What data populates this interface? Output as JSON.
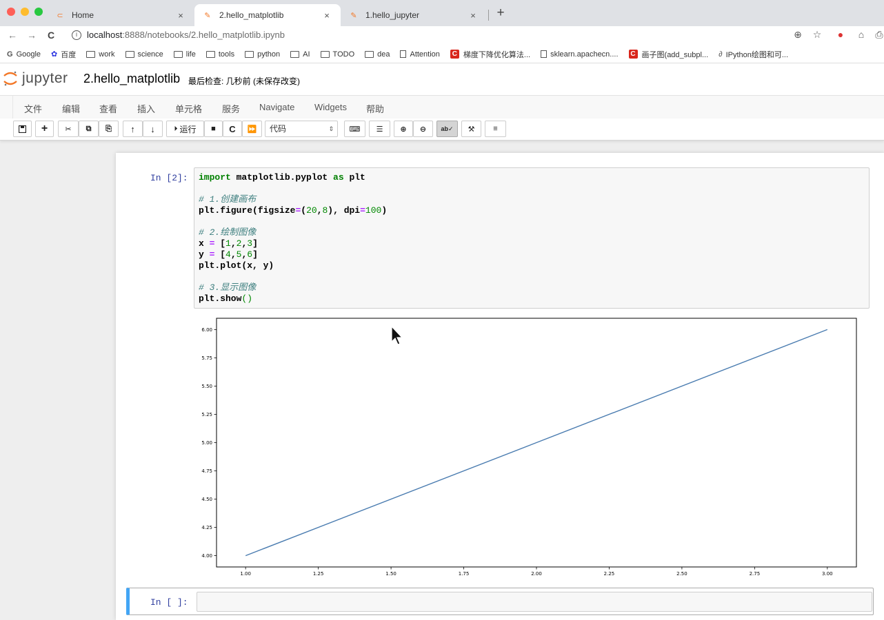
{
  "browser": {
    "tabs": [
      {
        "title": "Home",
        "close": "×"
      },
      {
        "title": "2.hello_matplotlib",
        "close": "×"
      },
      {
        "title": "1.hello_jupyter",
        "close": "×"
      }
    ],
    "new_tab": "+",
    "url_host": "localhost",
    "url_path": ":8888/notebooks/2.hello_matplotlib.ipynb",
    "bookmarks": [
      {
        "label": "Google",
        "kind": "google"
      },
      {
        "label": "百度",
        "kind": "baidu"
      },
      {
        "label": "work",
        "kind": "folder"
      },
      {
        "label": "science",
        "kind": "folder"
      },
      {
        "label": "life",
        "kind": "folder"
      },
      {
        "label": "tools",
        "kind": "folder"
      },
      {
        "label": "python",
        "kind": "folder"
      },
      {
        "label": "AI",
        "kind": "folder"
      },
      {
        "label": "TODO",
        "kind": "folder"
      },
      {
        "label": "dea",
        "kind": "folder"
      },
      {
        "label": "Attention",
        "kind": "doc"
      },
      {
        "label": "梯度下降优化算法...",
        "kind": "csdn"
      },
      {
        "label": "sklearn.apachecn....",
        "kind": "doc"
      },
      {
        "label": "画子图(add_subpl...",
        "kind": "csdn"
      },
      {
        "label": "IPython绘图和可...",
        "kind": "other"
      }
    ]
  },
  "jupyter": {
    "brand": "jupyter",
    "notebook_name": "2.hello_matplotlib",
    "checkpoint": "最后检查: 几秒前  (未保存改变)",
    "menus": [
      "文件",
      "编辑",
      "查看",
      "插入",
      "单元格",
      "服务",
      "Navigate",
      "Widgets",
      "帮助"
    ],
    "toolbar": {
      "run_label": "运行",
      "cell_type": "代码"
    }
  },
  "cells": [
    {
      "prompt": "In [2]:",
      "code": {
        "l1": {
          "k": "import",
          "a": " matplotlib.pyplot ",
          "k2": "as",
          "b": " plt"
        },
        "c1": "# 1.创建画布",
        "l2": {
          "a": "plt.figure(figsize",
          "eq": "=",
          "p1": "(",
          "n1": "20",
          "c": ",",
          "n2": "8",
          "p2": "), dpi",
          "eq2": "=",
          "n3": "100",
          "e": ")"
        },
        "c2": "# 2.绘制图像",
        "l3": {
          "a": "x ",
          "eq": "=",
          "b": " [",
          "n1": "1",
          "c1": ",",
          "n2": "2",
          "c2": ",",
          "n3": "3",
          "e": "]"
        },
        "l4": {
          "a": "y ",
          "eq": "=",
          "b": " [",
          "n1": "4",
          "c1": ",",
          "n2": "5",
          "c2": ",",
          "n3": "6",
          "e": "]"
        },
        "l5": "plt.plot(x, y)",
        "c3": "# 3.显示图像",
        "l6": {
          "a": "plt.show",
          "p": "()"
        }
      }
    },
    {
      "prompt": "In [ ]:"
    }
  ],
  "chart_data": {
    "type": "line",
    "x": [
      1.0,
      2.0,
      3.0
    ],
    "series": [
      {
        "values": [
          4,
          5,
          6
        ],
        "color": "#4a7cb0"
      }
    ],
    "xlim": [
      0.9,
      3.1
    ],
    "ylim": [
      3.9,
      6.1
    ],
    "xticks": [
      "1.00",
      "1.25",
      "1.50",
      "1.75",
      "2.00",
      "2.25",
      "2.50",
      "2.75",
      "3.00"
    ],
    "xtick_values": [
      1.0,
      1.25,
      1.5,
      1.75,
      2.0,
      2.25,
      2.5,
      2.75,
      3.0
    ],
    "yticks": [
      "4.00",
      "4.25",
      "4.50",
      "4.75",
      "5.00",
      "5.25",
      "5.50",
      "5.75",
      "6.00"
    ],
    "ytick_values": [
      4.0,
      4.25,
      4.5,
      4.75,
      5.0,
      5.25,
      5.5,
      5.75,
      6.0
    ],
    "grid": false
  }
}
